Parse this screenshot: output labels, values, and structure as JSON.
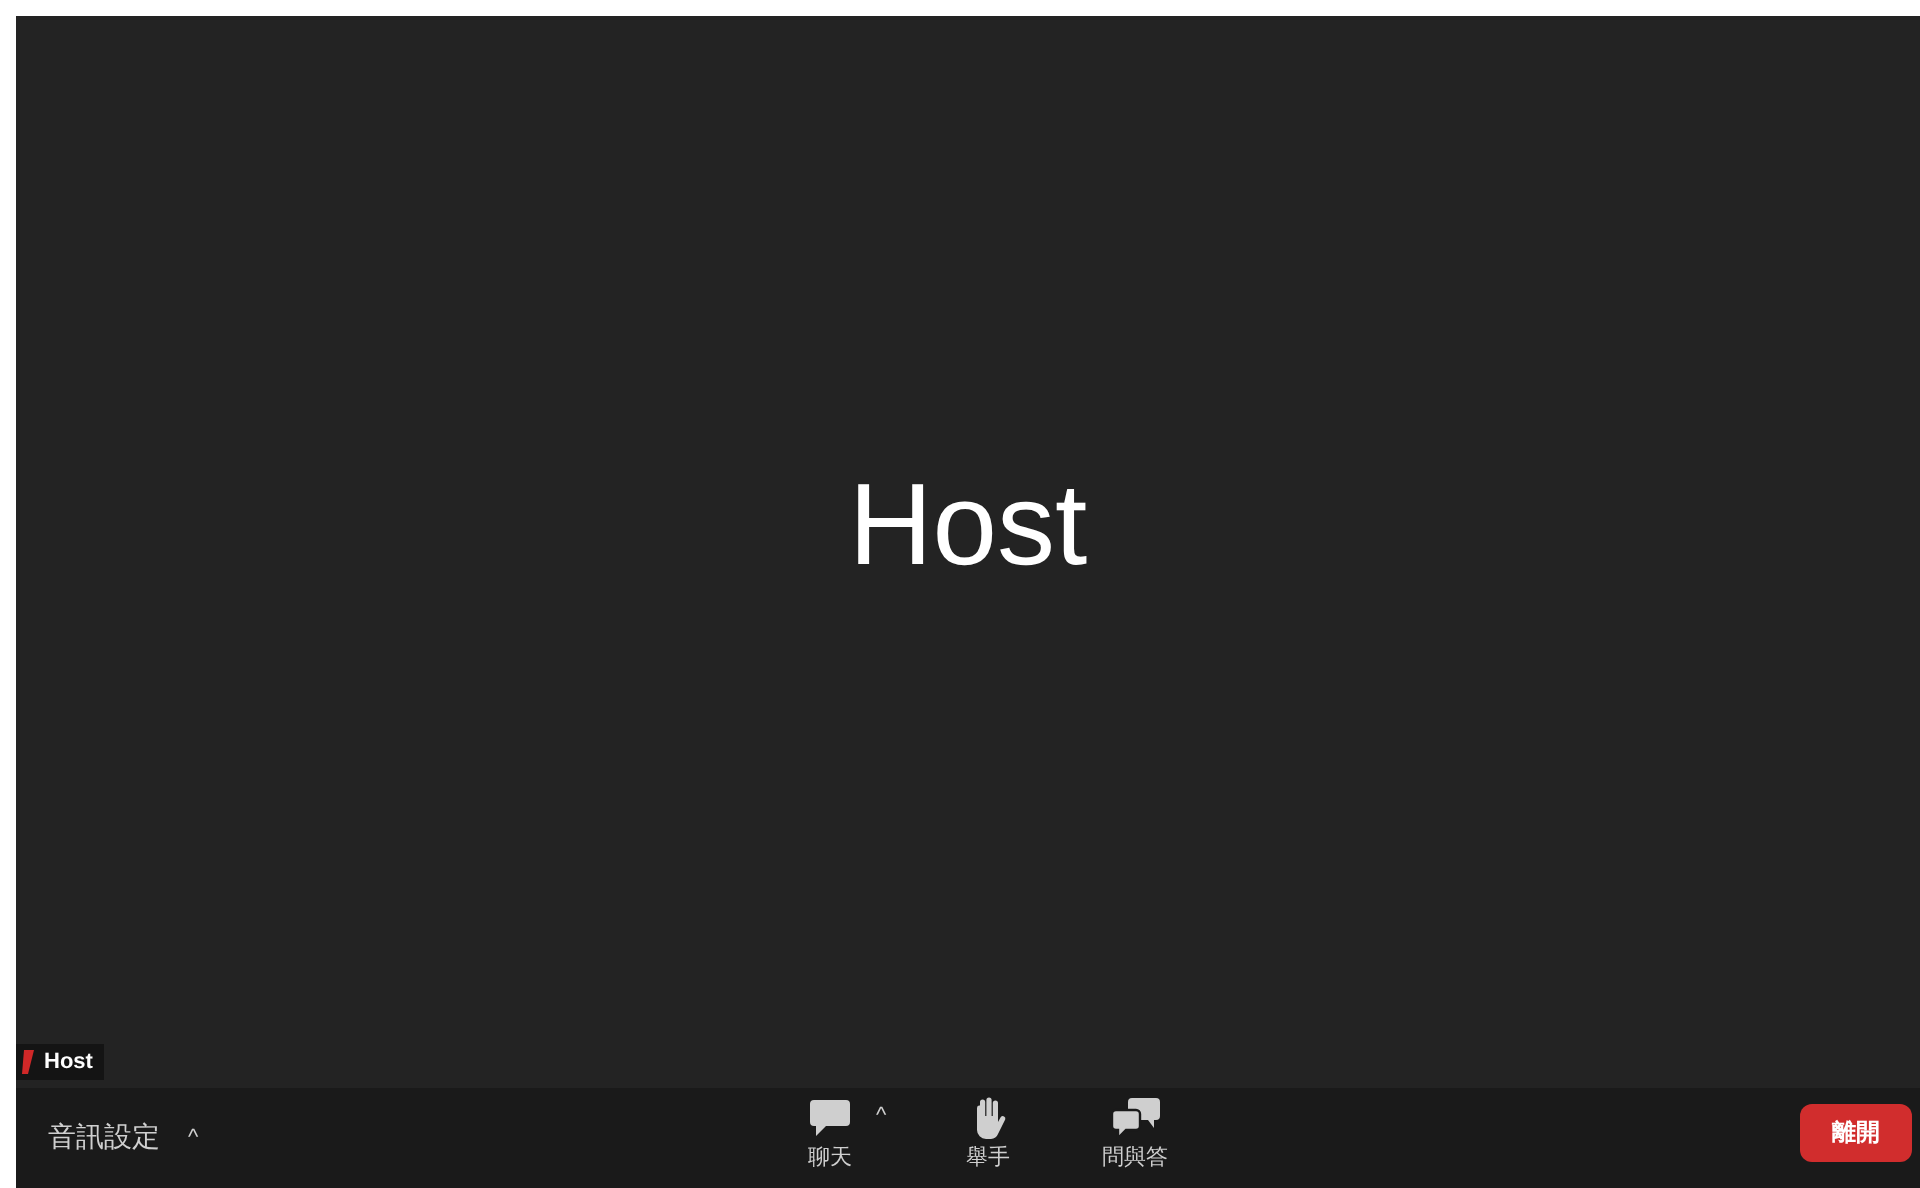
{
  "video": {
    "center_name": "Host",
    "name_tag": "Host"
  },
  "toolbar": {
    "audio_settings": "音訊設定",
    "audio_caret": "^",
    "buttons": [
      {
        "kind": "chat",
        "label": "聊天",
        "caret": "^"
      },
      {
        "kind": "raise-hand",
        "label": "舉手"
      },
      {
        "kind": "qa",
        "label": "問與答"
      }
    ],
    "leave": "離開"
  }
}
